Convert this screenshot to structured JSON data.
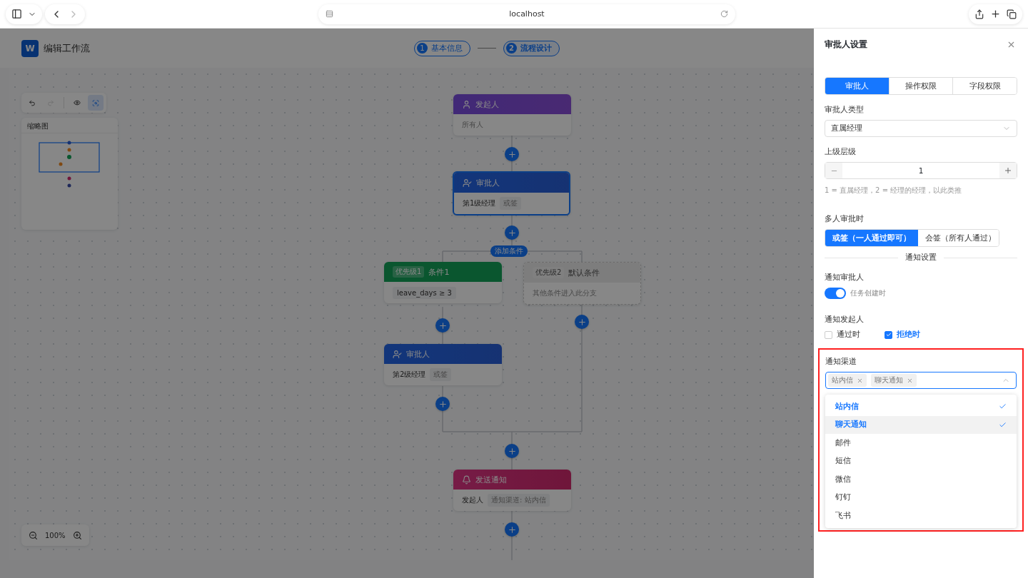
{
  "browser": {
    "url": "localhost"
  },
  "app": {
    "logo": "W",
    "title": "编辑工作流"
  },
  "steps": [
    {
      "number": "1",
      "label": "基本信息",
      "selected": false
    },
    {
      "number": "2",
      "label": "流程设计",
      "selected": true
    }
  ],
  "toolbar": {
    "tools": [
      {
        "kind": "undo",
        "disabled": false,
        "selected": false
      },
      {
        "kind": "redo",
        "disabled": true,
        "selected": false
      },
      {
        "kind": "preview",
        "disabled": false,
        "selected": false
      },
      {
        "kind": "focus",
        "disabled": false,
        "selected": true
      }
    ]
  },
  "minimap": {
    "title": "缩略图"
  },
  "flow": {
    "add_condition": "添加条件",
    "nodes": [
      {
        "kind": "start",
        "title": "发起人",
        "body": "所有人",
        "selected": false
      },
      {
        "kind": "approver",
        "title": "审批人",
        "body": "第1级经理",
        "tag": "或签",
        "selected": true
      },
      {
        "kind": "condition",
        "priority": "优先级1",
        "title": "条件1",
        "body": "leave_days ≥ 3",
        "selected": false
      },
      {
        "kind": "default",
        "priority": "优先级2",
        "title": "默认条件",
        "body": "其他条件进入此分支",
        "selected": false
      },
      {
        "kind": "approver",
        "title": "审批人",
        "body": "第2级经理",
        "tag": "或签",
        "selected": false
      },
      {
        "kind": "notify",
        "title": "发送通知",
        "body": "发起人",
        "tag": "通知渠道: 站内信",
        "selected": false
      }
    ]
  },
  "zoom": {
    "value": "100%"
  },
  "drawer": {
    "title": "审批人设置",
    "tabs": [
      {
        "label": "审批人",
        "selected": true
      },
      {
        "label": "操作权限",
        "selected": false
      },
      {
        "label": "字段权限",
        "selected": false
      }
    ],
    "approver_type": {
      "label": "审批人类型",
      "value": "直属经理"
    },
    "level": {
      "label": "上级层级",
      "value": "1",
      "hint": "1 = 直属经理，2 = 经理的经理，以此类推"
    },
    "multi": {
      "label": "多人审批时",
      "options": [
        {
          "label": "或签（一人通过即可）",
          "selected": true
        },
        {
          "label": "会签（所有人通过）",
          "selected": false
        }
      ]
    },
    "notify_section": "通知设置",
    "notify_approver": {
      "label": "通知审批人",
      "switch_label": "任务创建时",
      "on": true
    },
    "notify_initiator": {
      "label": "通知发起人",
      "options": [
        {
          "label": "通过时",
          "checked": false
        },
        {
          "label": "拒绝时",
          "checked": true
        }
      ]
    },
    "channels": {
      "label": "通知渠道",
      "highlighted": true,
      "expanded": true,
      "tags": [
        "站内信",
        "聊天通知"
      ],
      "options": [
        {
          "label": "站内信",
          "selected": true,
          "hovered": false
        },
        {
          "label": "聊天通知",
          "selected": true,
          "hovered": true
        },
        {
          "label": "邮件",
          "selected": false,
          "hovered": false
        },
        {
          "label": "短信",
          "selected": false,
          "hovered": false
        },
        {
          "label": "微信",
          "selected": false,
          "hovered": false
        },
        {
          "label": "钉钉",
          "selected": false,
          "hovered": false
        },
        {
          "label": "飞书",
          "selected": false,
          "hovered": false
        }
      ]
    }
  }
}
